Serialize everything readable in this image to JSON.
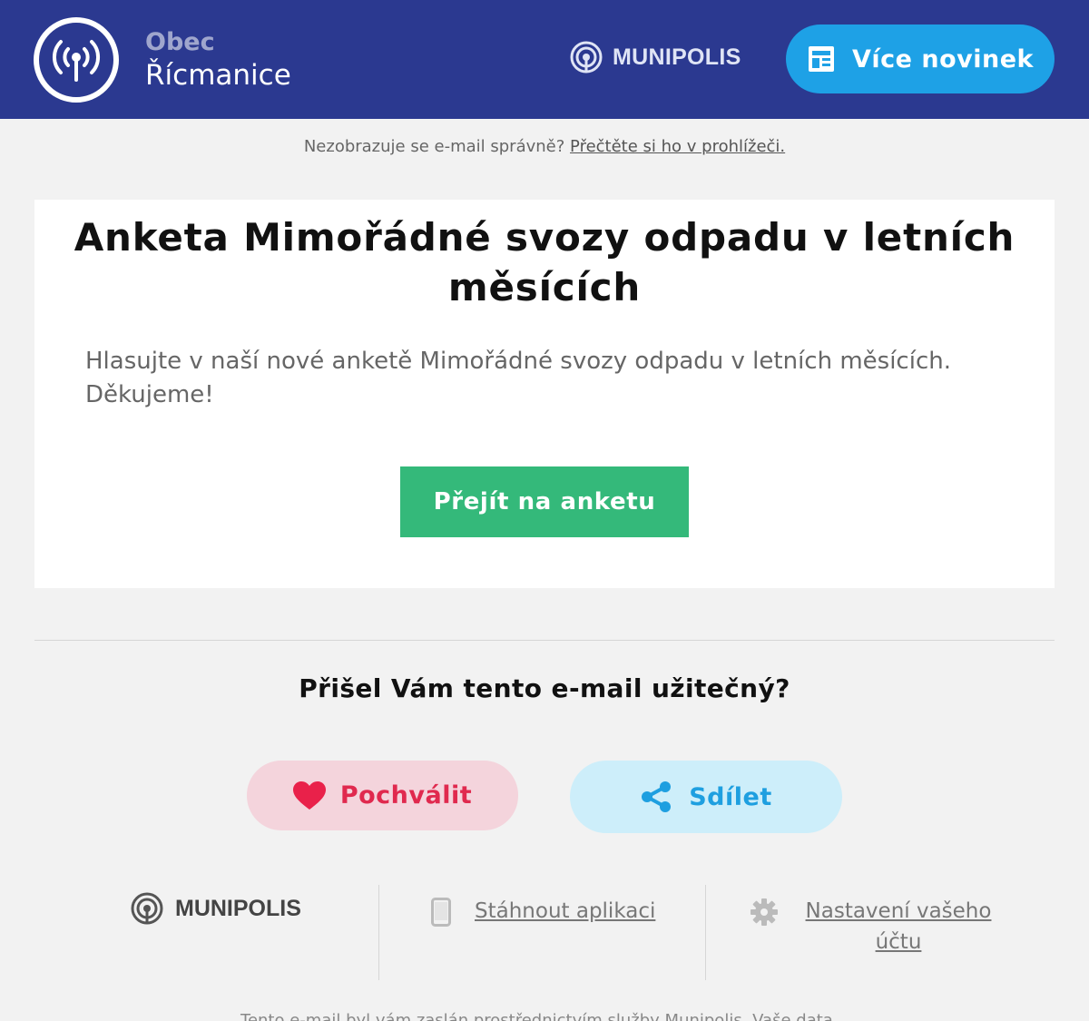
{
  "header": {
    "municipality_prefix": "Obec",
    "municipality_name": "Řícmanice",
    "brand": "MUNIPOLIS",
    "more_news_label": "Více novinek"
  },
  "notice": {
    "text": "Nezobrazuje se e-mail správně?",
    "link": "Přečtěte si ho v prohlížeči."
  },
  "card": {
    "title": "Anketa Mimořádné svozy odpadu v letních měsících",
    "body": "Hlasujte v naší nové anketě Mimořádné svozy odpadu v letních měsících. Děkujeme!",
    "cta_label": "Přejít na anketu"
  },
  "feedback": {
    "question": "Přišel Vám tento e-mail užitečný?",
    "praise_label": "Pochválit",
    "share_label": "Sdílet"
  },
  "footer": {
    "brand": "MUNIPOLIS",
    "download_app": "Stáhnout aplikaci",
    "settings_line1": "Nastavení vašeho",
    "settings_line2": "účtu",
    "cut_text": "Tento e-mail byl vám zaslán prostřednictvím služby Munipolis. Vaše data..."
  },
  "colors": {
    "header_bg": "#2b3990",
    "more_news_bg": "#1ea1e6",
    "cta_bg": "#34b97a",
    "praise_bg": "#f4d4dc",
    "praise_fg": "#e0294e",
    "share_bg": "#cdeefa",
    "share_fg": "#1e9fe0"
  },
  "icons": {
    "logo": "broadcast-antenna-icon",
    "brand": "munipolis-signal-icon",
    "more_news": "newspaper-icon",
    "praise": "heart-icon",
    "share": "share-icon",
    "download": "phone-icon",
    "settings": "gear-icon"
  }
}
